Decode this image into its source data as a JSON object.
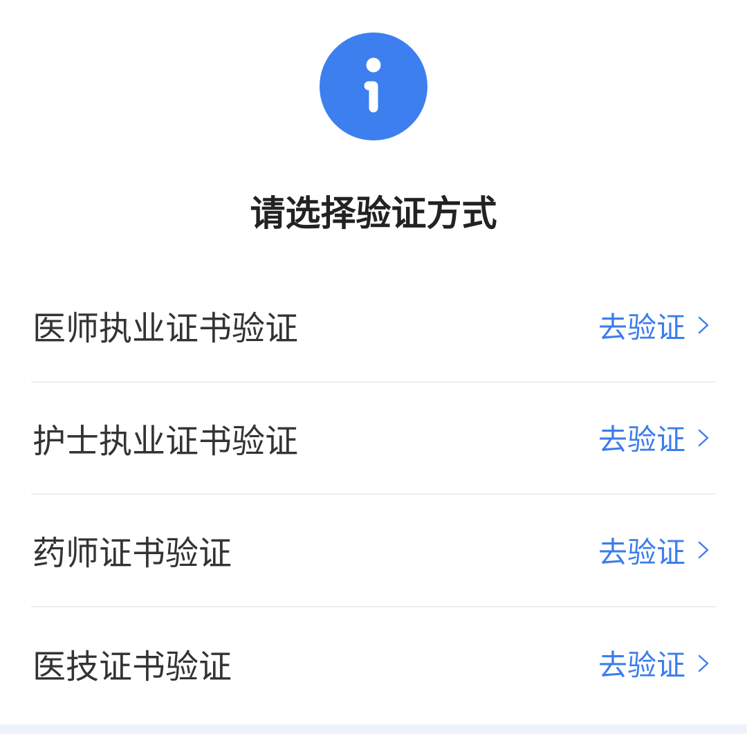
{
  "colors": {
    "accent": "#3B7DED",
    "icon_fill": "#3D7FEE",
    "divider": "#EEEEEE",
    "bottom_band": "#EEF3FB"
  },
  "header": {
    "icon": "info-icon",
    "title": "请选择验证方式"
  },
  "options": [
    {
      "label": "医师执业证书验证",
      "action_label": "去验证",
      "action_icon": "chevron-right-icon"
    },
    {
      "label": "护士执业证书验证",
      "action_label": "去验证",
      "action_icon": "chevron-right-icon"
    },
    {
      "label": "药师证书验证",
      "action_label": "去验证",
      "action_icon": "chevron-right-icon"
    },
    {
      "label": "医技证书验证",
      "action_label": "去验证",
      "action_icon": "chevron-right-icon"
    }
  ]
}
